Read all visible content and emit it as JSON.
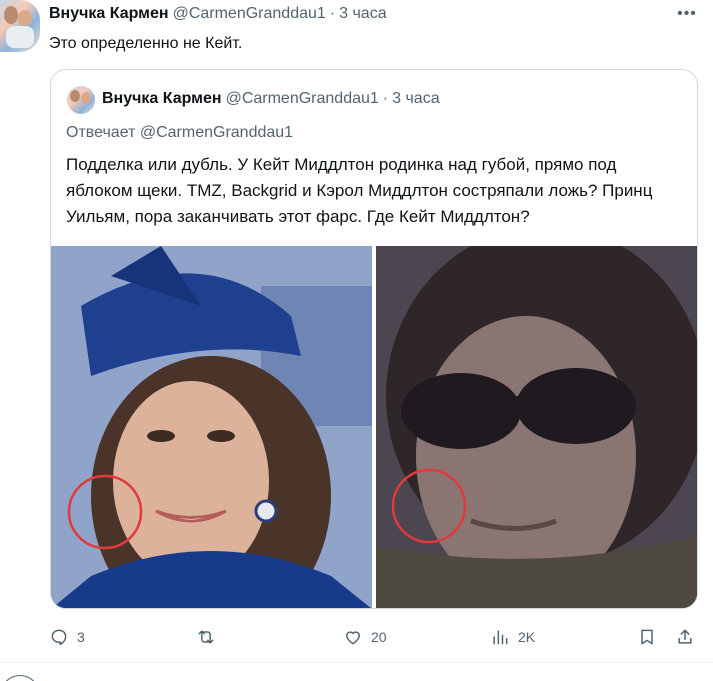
{
  "tweet": {
    "author_name": "Внучка Кармен",
    "author_handle": "@CarmenGranddau1",
    "separator": "·",
    "time": "3 часа",
    "more_label": "•••",
    "text": "Это определенно не Кейт."
  },
  "quote": {
    "author_name": "Внучка Кармен",
    "author_handle": "@CarmenGranddau1",
    "separator": "·",
    "time": "3 часа",
    "reply_prefix": "Отвечает",
    "reply_mention": "@CarmenGranddau1",
    "text": "Подделка или дубль. У Кейт Миддлтон родинка над губой, прямо под яблоком щеки. TMZ, Backgrid и Кэрол Миддлтон состряпали ложь? Принц Уильям, пора заканчивать этот фарс. Где Кейт Миддлтон?"
  },
  "actions": {
    "replies": "3",
    "retweets": "",
    "likes": "20",
    "views": "2K"
  },
  "colors": {
    "text_primary": "#0f1419",
    "text_secondary": "#536471",
    "border": "#cfd9de",
    "highlight_circle": "#e03a3a"
  }
}
